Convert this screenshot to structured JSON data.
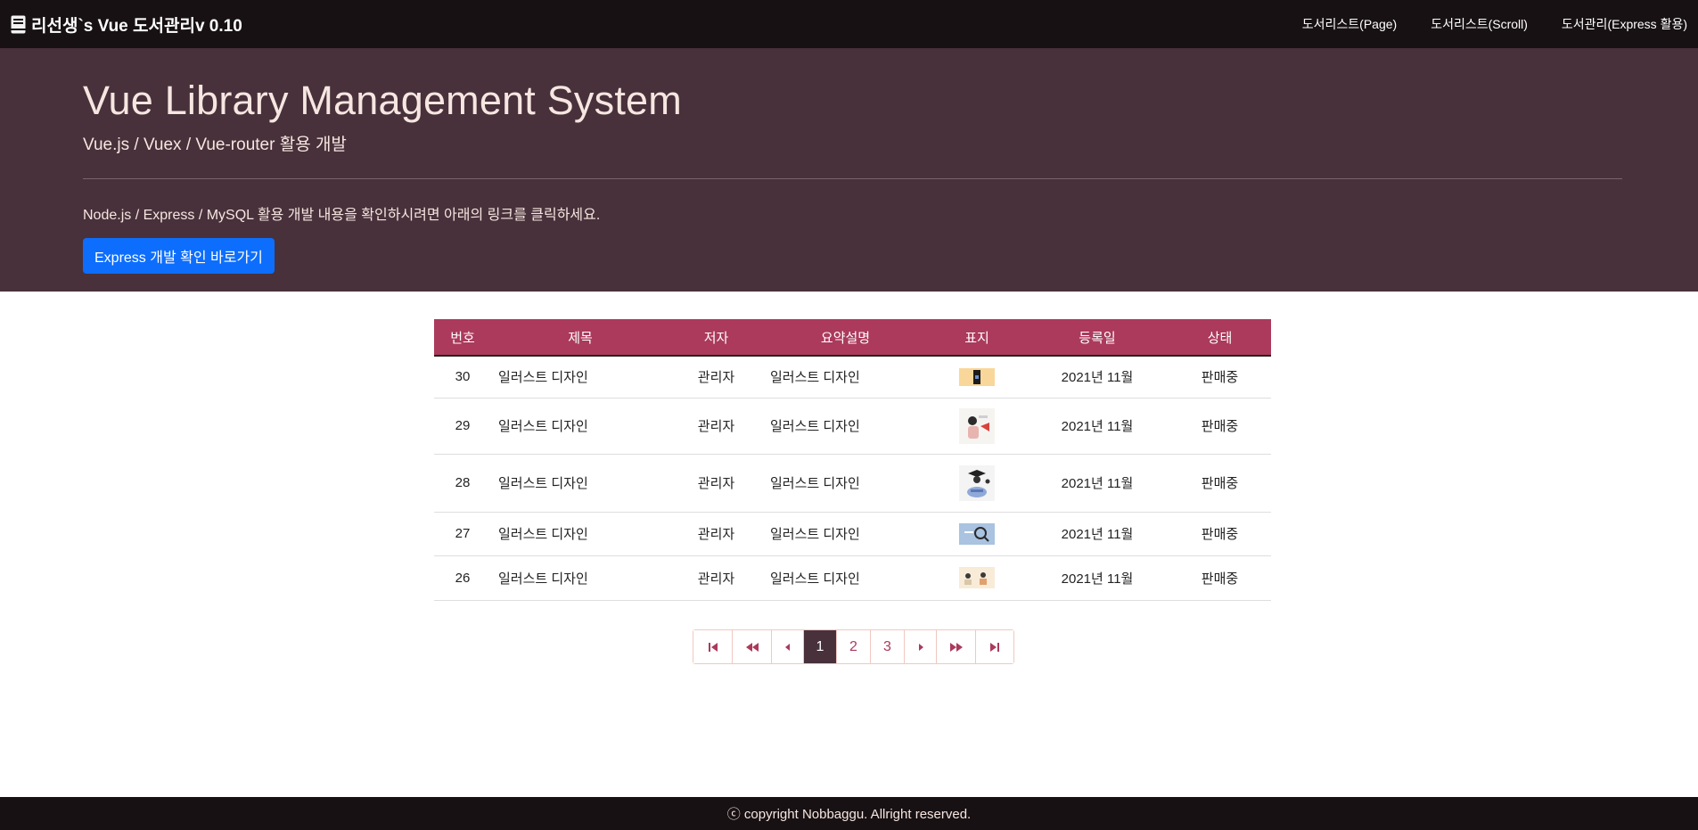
{
  "navbar": {
    "brand": "리선생`s Vue 도서관리v 0.10",
    "links": [
      {
        "label": "도서리스트(Page)"
      },
      {
        "label": "도서리스트(Scroll)"
      },
      {
        "label": "도서관리(Express 활용)"
      }
    ]
  },
  "hero": {
    "title": "Vue Library Management System",
    "subtitle": "Vue.js / Vuex / Vue-router 활용 개발",
    "description": "Node.js / Express / MySQL 활용 개발 내용을 확인하시려면 아래의 링크를 클릭하세요.",
    "button_label": "Express 개발 확인 바로가기"
  },
  "table": {
    "headers": [
      "번호",
      "제목",
      "저자",
      "요약설명",
      "표지",
      "등록일",
      "상태"
    ],
    "rows": [
      {
        "no": "30",
        "title": "일러스트 디자인",
        "author": "관리자",
        "summary": "일러스트 디자인",
        "cover": "cover-image-30",
        "date": "2021년 11월",
        "status": "판매중"
      },
      {
        "no": "29",
        "title": "일러스트 디자인",
        "author": "관리자",
        "summary": "일러스트 디자인",
        "cover": "cover-image-29",
        "date": "2021년 11월",
        "status": "판매중"
      },
      {
        "no": "28",
        "title": "일러스트 디자인",
        "author": "관리자",
        "summary": "일러스트 디자인",
        "cover": "cover-image-28",
        "date": "2021년 11월",
        "status": "판매중"
      },
      {
        "no": "27",
        "title": "일러스트 디자인",
        "author": "관리자",
        "summary": "일러스트 디자인",
        "cover": "cover-image-27",
        "date": "2021년 11월",
        "status": "판매중"
      },
      {
        "no": "26",
        "title": "일러스트 디자인",
        "author": "관리자",
        "summary": "일러스트 디자인",
        "cover": "cover-image-26",
        "date": "2021년 11월",
        "status": "판매중"
      }
    ]
  },
  "pagination": {
    "first_icon": "skip-to-first-icon",
    "prev_block_icon": "double-chevron-left-icon",
    "prev_icon": "caret-left-icon",
    "pages": [
      "1",
      "2",
      "3"
    ],
    "current": "1",
    "next_icon": "caret-right-icon",
    "next_block_icon": "double-chevron-right-icon",
    "last_icon": "skip-to-last-icon"
  },
  "footer": {
    "text": "ⓒ copyright Nobbaggu. Allright reserved."
  },
  "colors": {
    "navbar_bg": "#171113",
    "hero_bg": "#48313b",
    "table_header_bg": "#ab3a5c",
    "button_primary": "#0d6efd",
    "page_active_bg": "#48313b"
  }
}
